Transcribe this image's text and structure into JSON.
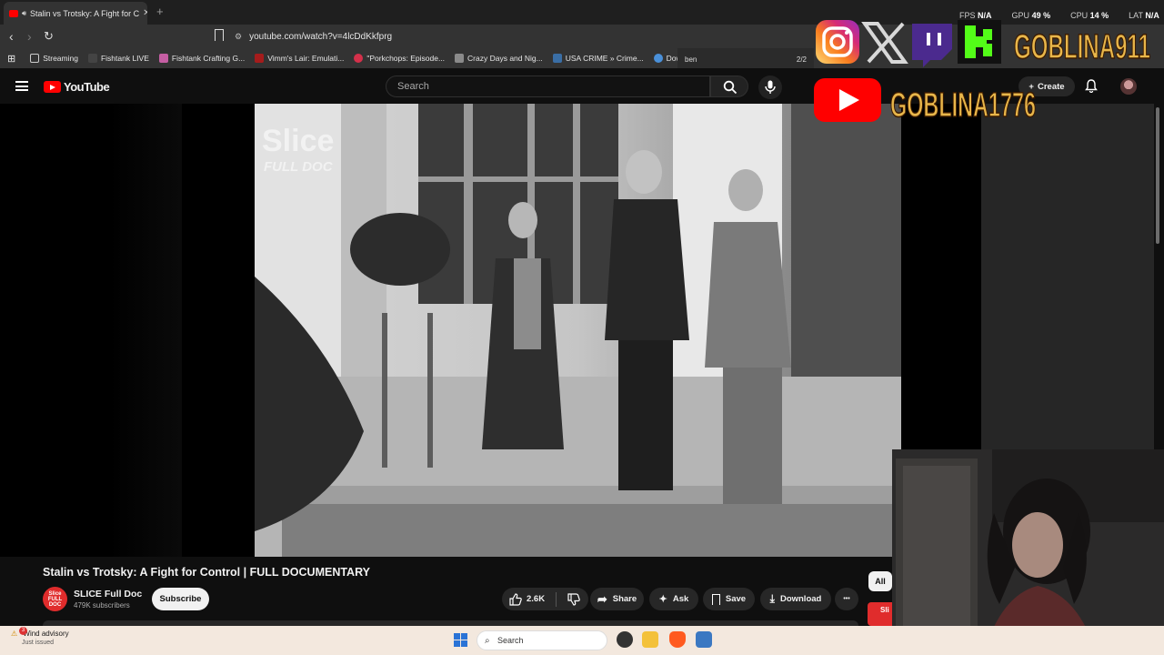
{
  "browser": {
    "tab_title": "Stalin vs Trotsky: A Fight for C",
    "new_tab_glyph": "+",
    "url": "youtube.com/watch?v=4lcDdKkfprg",
    "bookmarks": [
      {
        "label": "Streaming",
        "color": "#9aa0a6"
      },
      {
        "label": "Fishtank LIVE",
        "color": "#444444"
      },
      {
        "label": "Fishtank Crafting G...",
        "color": "#c55ea3"
      },
      {
        "label": "Vimm's Lair: Emulati...",
        "color": "#a51c1c"
      },
      {
        "label": "\"Porkchops: Episode...",
        "color": "#d4304a"
      },
      {
        "label": "Crazy Days and Nig...",
        "color": "#8a8a8a"
      },
      {
        "label": "USA CRIME » Crime...",
        "color": "#3a6ea5"
      },
      {
        "label": "Down Dog",
        "color": "#4a90d9"
      }
    ],
    "find_text": "ben",
    "find_count": "2/2"
  },
  "stats": {
    "fps_label": "FPS",
    "fps_value": "N/A",
    "gpu_label": "GPU",
    "gpu_value": "49 %",
    "cpu_label": "CPU",
    "cpu_value": "14 %",
    "lat_label": "LAT",
    "lat_value": "N/A"
  },
  "overlay": {
    "handle_top": "GOBLINA911",
    "handle_bottom": "GOBLINA1776"
  },
  "youtube": {
    "logo_text": "YouTube",
    "search_placeholder": "Search",
    "create_label": "Create",
    "watermark_line1": "Slice",
    "watermark_line2": "FULL DOC",
    "video_title": "Stalin vs Trotsky: A Fight for Control | FULL DOCUMENTARY",
    "channel_avatar_text": "Slice FULL DOC",
    "channel_name": "SLICE Full Doc",
    "channel_subs": "479K subscribers",
    "subscribe_label": "Subscribe",
    "like_count": "2.6K",
    "share_label": "Share",
    "ask_label": "Ask",
    "save_label": "Save",
    "download_label": "Download",
    "more_glyph": "•••",
    "chip_all": "All",
    "chip_red": "Sli"
  },
  "taskbar": {
    "weather_title": "Wind advisory",
    "weather_sub": "Just issued",
    "weather_badge": "3",
    "search_label": "Search"
  }
}
